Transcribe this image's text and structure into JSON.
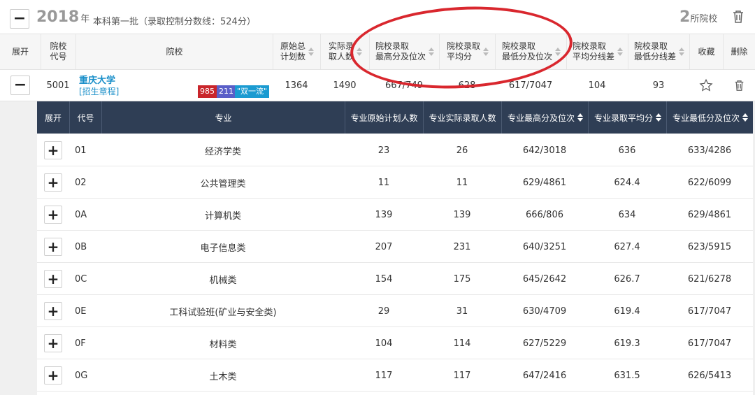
{
  "topbar": {
    "collapse_symbol": "−",
    "year": "2018",
    "year_unit": "年",
    "batch": "本科第一批（录取控制分数线：524分）",
    "school_count": "2",
    "school_count_unit": "所院校"
  },
  "icons": {
    "trash": "trash-icon",
    "star": "star-outline-icon",
    "plus": "plus-icon",
    "minus": "minus-icon"
  },
  "colors": {
    "header_dark": "#2f3e55",
    "link": "#1a8fc9",
    "highlight": "#d9272e",
    "badge_985": "#c9252b",
    "badge_211": "#5a5fc8",
    "badge_dfc": "#1b9bd1"
  },
  "school_header": {
    "expand": "展开",
    "code_line1": "院校",
    "code_line2": "代号",
    "name": "院校",
    "plan_line1": "原始总",
    "plan_line2": "计划数",
    "actual_line1": "实际录",
    "actual_line2": "取人数",
    "max_line1": "院校录取",
    "max_line2": "最高分及位次",
    "avg_line1": "院校录取",
    "avg_line2": "平均分",
    "min_line1": "院校录取",
    "min_line2": "最低分及位次",
    "avgdiff_line1": "院校录取",
    "avgdiff_line2": "平均分线差",
    "mindiff_line1": "院校录取",
    "mindiff_line2": "最低分线差",
    "favorite": "收藏",
    "delete": "删除"
  },
  "school": {
    "collapse_symbol": "−",
    "code": "5001",
    "name": "重庆大学",
    "link": "[招生章程]",
    "badges": [
      "985",
      "211",
      "\"双一流\""
    ],
    "plan": "1364",
    "actual": "1490",
    "max": "667/749",
    "avg": "628",
    "min": "617/7047",
    "avg_diff": "104",
    "min_diff": "93",
    "star": "☆",
    "trash": "🗑"
  },
  "major_header": {
    "expand": "展开",
    "code": "代号",
    "name": "专业",
    "plan": "专业原始计划人数",
    "actual": "专业实际录取人数",
    "max": "专业最高分及位次",
    "avg": "专业录取平均分",
    "min": "专业最低分及位次"
  },
  "majors": [
    {
      "plus": "+",
      "code": "01",
      "name": "经济学类",
      "plan": "23",
      "actual": "26",
      "max": "642/3018",
      "avg": "636",
      "min": "633/4286"
    },
    {
      "plus": "+",
      "code": "02",
      "name": "公共管理类",
      "plan": "11",
      "actual": "11",
      "max": "629/4861",
      "avg": "624.4",
      "min": "622/6099"
    },
    {
      "plus": "+",
      "code": "0A",
      "name": "计算机类",
      "plan": "139",
      "actual": "139",
      "max": "666/806",
      "avg": "634",
      "min": "629/4861"
    },
    {
      "plus": "+",
      "code": "0B",
      "name": "电子信息类",
      "plan": "207",
      "actual": "231",
      "max": "640/3251",
      "avg": "627.4",
      "min": "623/5915"
    },
    {
      "plus": "+",
      "code": "0C",
      "name": "机械类",
      "plan": "154",
      "actual": "175",
      "max": "645/2642",
      "avg": "626.7",
      "min": "621/6278"
    },
    {
      "plus": "+",
      "code": "0E",
      "name": "工科试验班(矿业与安全类)",
      "plan": "29",
      "actual": "31",
      "max": "630/4709",
      "avg": "619.4",
      "min": "617/7047"
    },
    {
      "plus": "+",
      "code": "0F",
      "name": "材料类",
      "plan": "104",
      "actual": "114",
      "max": "627/5229",
      "avg": "619.3",
      "min": "617/7047"
    },
    {
      "plus": "+",
      "code": "0G",
      "name": "土木类",
      "plan": "117",
      "actual": "117",
      "max": "647/2416",
      "avg": "631.5",
      "min": "626/5413"
    }
  ]
}
